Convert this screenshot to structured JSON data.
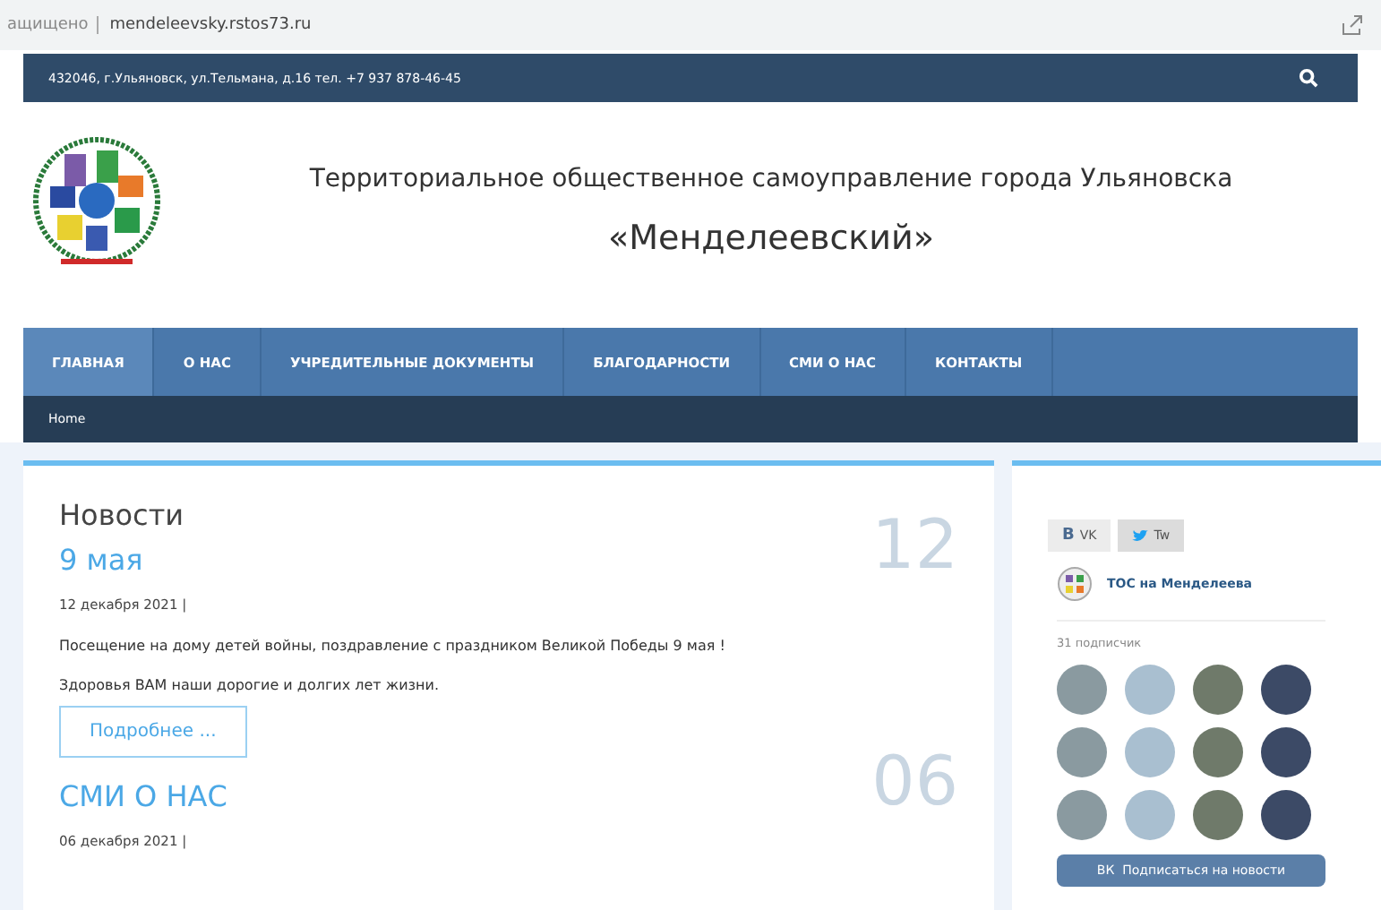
{
  "browser": {
    "security": "ащищено",
    "url": "mendeleevsky.rstos73.ru"
  },
  "topbar": {
    "contact": "432046, г.Ульяновск, ул.Тельмана, д.16  тел. +7 937 878-46-45"
  },
  "header": {
    "title": "Территориальное общественное самоуправление города Ульяновска",
    "name": "«Менделеевский»"
  },
  "nav": [
    {
      "label": "ГЛАВНАЯ",
      "selected": true
    },
    {
      "label": "О НАС",
      "selected": false
    },
    {
      "label": "УЧРЕДИТЕЛЬНЫЕ ДОКУМЕНТЫ",
      "selected": false
    },
    {
      "label": "БЛАГОДАРНОСТИ",
      "selected": false
    },
    {
      "label": "СМИ О НАС",
      "selected": false
    },
    {
      "label": "КОНТАКТЫ",
      "selected": false
    }
  ],
  "breadcrumb": "Home",
  "news": {
    "heading": "Новости",
    "items": [
      {
        "title": "9 мая",
        "day": "12",
        "date": "12 декабря 2021 |",
        "text": [
          "Посещение на дому детей войны, поздравление с праздником Великой Победы 9 мая !",
          "Здоровья ВАМ наши дорогие и долгих лет жизни."
        ],
        "more": "Подробнее ..."
      },
      {
        "title": "СМИ О НАС",
        "day": "06",
        "date": "06 декабря 2021 |"
      }
    ]
  },
  "widget": {
    "tabs": [
      {
        "label": "VK",
        "kind": "vk",
        "icon": "B"
      },
      {
        "label": "Tw",
        "kind": "tw"
      }
    ],
    "group": "ТОС на Менделеева",
    "subscribers": "31 подписчик",
    "avatars": [
      {
        "kind": "photo"
      },
      {
        "kind": "photo"
      },
      {
        "kind": "photo"
      },
      {
        "kind": "photo"
      },
      {
        "kind": "photo"
      },
      {
        "kind": "photo"
      },
      {
        "kind": "photo"
      },
      {
        "kind": "photo"
      },
      {
        "kind": "photo"
      },
      {
        "kind": "photo"
      },
      {
        "kind": "photo"
      },
      {
        "kind": "photo"
      }
    ],
    "subscribe_icon": "ВК",
    "subscribe": "Подписаться на новости"
  }
}
